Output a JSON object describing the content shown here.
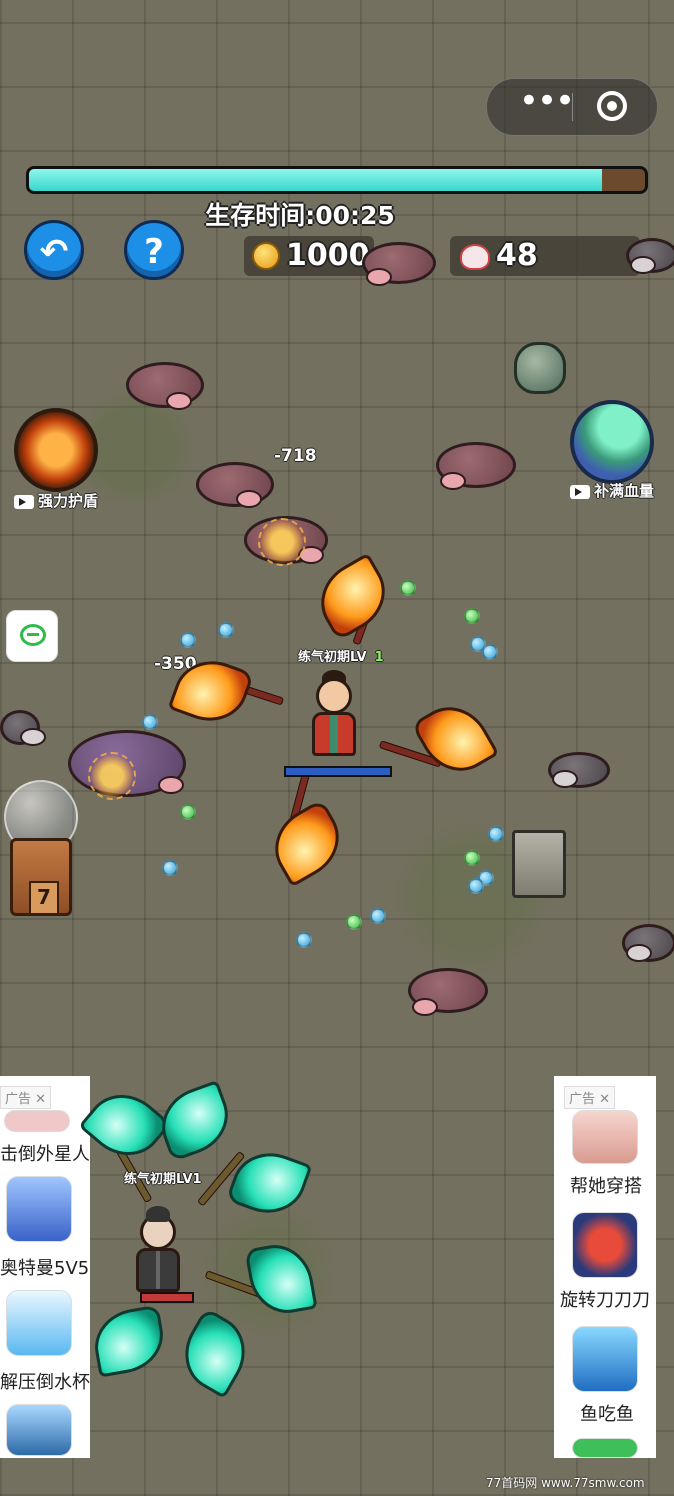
{
  "capsule": {
    "more_icon": "more-dots-icon",
    "close_icon": "target-icon",
    "more_glyph": "•••"
  },
  "hud": {
    "progress_fraction": 0.93,
    "survival_label": "生存时间:00:25",
    "gold": "1000",
    "kills": "48",
    "back_icon": "back-arrow-icon",
    "help_icon": "help-pause-icon"
  },
  "skills": {
    "shield_label": "强力护盾",
    "heal_label": "补满血量"
  },
  "player": {
    "level_text": "练气初期LV",
    "level_num": "1"
  },
  "ally": {
    "level_text": "练气初期LV1"
  },
  "damage_numbers": [
    "-718",
    "-350"
  ],
  "chest": {
    "count": "7"
  },
  "ads": {
    "left_tag": "广告",
    "right_tag": "广告",
    "left_items": [
      "击倒外星人",
      "奥特曼5V5",
      "解压倒水杯"
    ],
    "right_items": [
      "帮她穿搭",
      "旋转刀刀刀",
      "鱼吃鱼"
    ]
  },
  "watermark": "77首码网 www.77smw.com",
  "colors": {
    "progress": "#39d6cb",
    "button_blue": "#1d8fe6",
    "fire": "#ff9a1a",
    "jade": "#27e0b7"
  }
}
